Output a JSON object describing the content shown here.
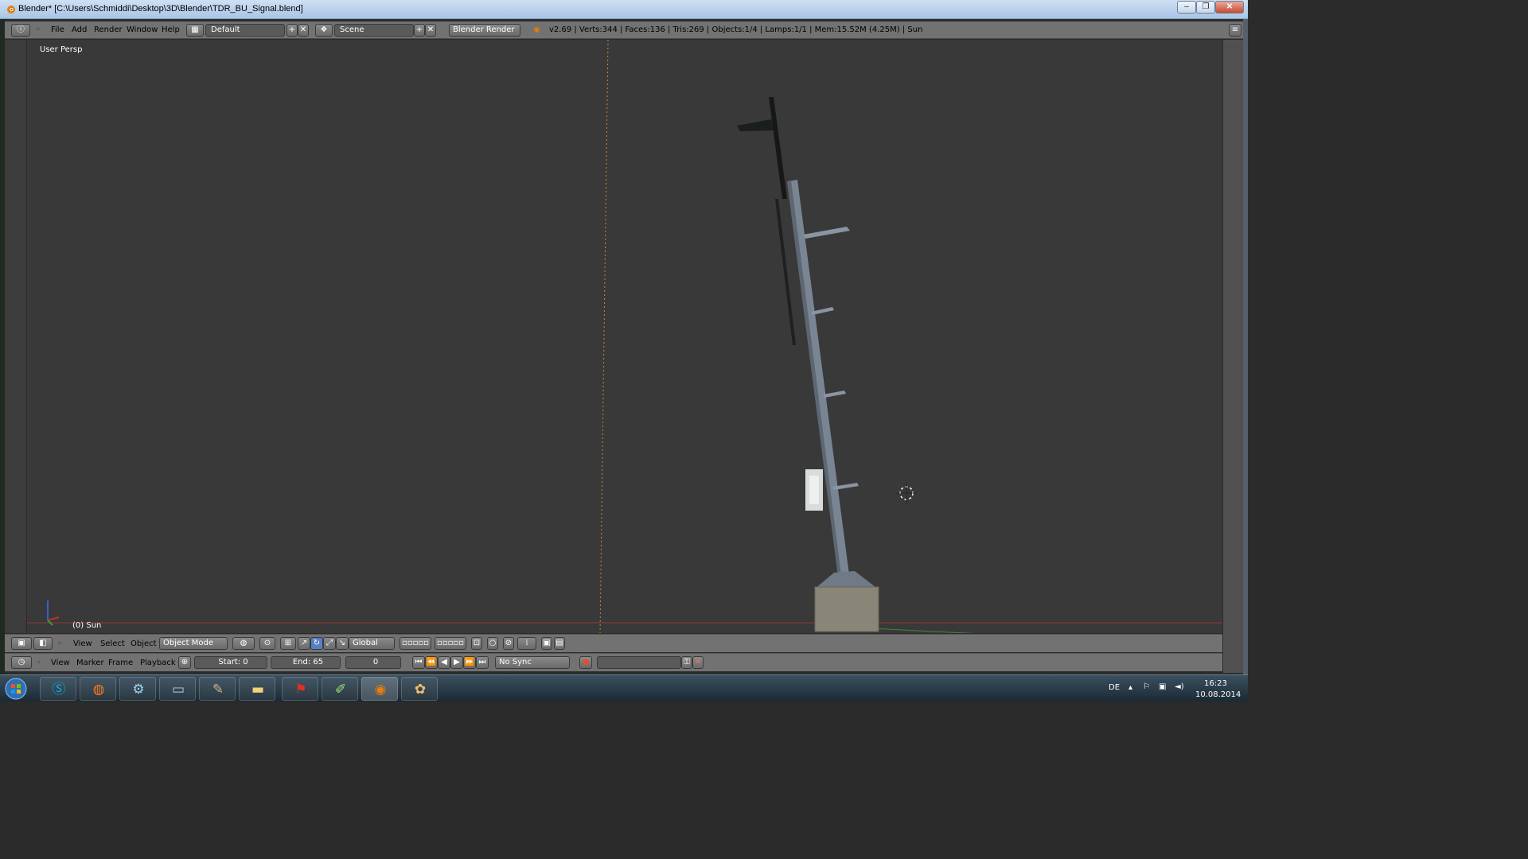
{
  "window": {
    "title": "Blender* [C:\\Users\\Schmiddi\\Desktop\\3D\\Blender\\TDR_BU_Signal.blend]",
    "controls": [
      "–",
      "❐",
      "✕"
    ]
  },
  "header": {
    "menus": [
      "File",
      "Add",
      "Render",
      "Window",
      "Help"
    ],
    "layout": "Default",
    "scene": "Scene",
    "engine": "Blender Render",
    "stats": "v2.69 | Verts:344 | Faces:136 | Tris:269 | Objects:1/4 | Lamps:1/1 | Mem:15.52M (4.25M) | Sun"
  },
  "viewport": {
    "view_label": "User Persp",
    "frame_label": "(0) Sun"
  },
  "view3d_header": {
    "menus": [
      "View",
      "Select",
      "Object"
    ],
    "mode": "Object Mode",
    "orientation": "Global"
  },
  "timeline_header": {
    "menus": [
      "View",
      "Marker",
      "Frame",
      "Playback"
    ],
    "start": "Start: 0",
    "end": "End: 65",
    "current": "0",
    "sync": "No Sync"
  },
  "taskbar": {
    "apps": [
      "start",
      "skype",
      "firefox",
      "network-tool",
      "window-manager",
      "gimp",
      "file-explorer",
      "acrobat",
      "notepad-plus-plus",
      "blender",
      "paint"
    ],
    "lang": "DE",
    "time": "16:23",
    "date": "10.08.2014"
  },
  "colors": {
    "viewport_bg": "#393939",
    "header_bg": "#727272",
    "accent_orange": "#e87d0d"
  }
}
